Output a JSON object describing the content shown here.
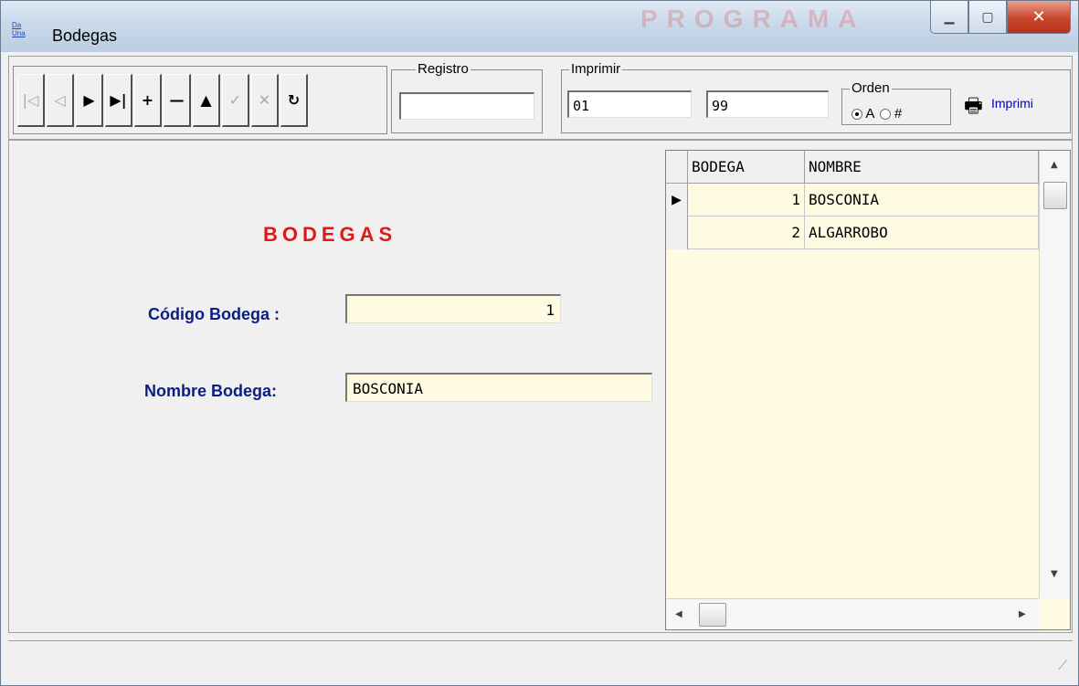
{
  "window": {
    "title": "Bodegas",
    "app_icon_text_top": "Da",
    "app_icon_text_bottom": "Una",
    "minimize_icon": "minimize-icon",
    "maximize_icon": "maximize-icon",
    "close_icon": "close-icon"
  },
  "toolbar": {
    "nav_buttons": [
      {
        "name": "first-record-icon",
        "glyph": "|◁",
        "enabled": false
      },
      {
        "name": "previous-record-icon",
        "glyph": "◁",
        "enabled": false
      },
      {
        "name": "next-record-icon",
        "glyph": "▶",
        "enabled": true
      },
      {
        "name": "last-record-icon",
        "glyph": "▶|",
        "enabled": true
      },
      {
        "name": "add-record-icon",
        "glyph": "+",
        "enabled": true
      },
      {
        "name": "delete-record-icon",
        "glyph": "—",
        "enabled": true
      },
      {
        "name": "edit-record-icon",
        "glyph": "▲",
        "enabled": true
      },
      {
        "name": "save-record-icon",
        "glyph": "✓",
        "enabled": false
      },
      {
        "name": "cancel-record-icon",
        "glyph": "✕",
        "enabled": false
      },
      {
        "name": "refresh-icon",
        "glyph": "↻",
        "enabled": true
      }
    ],
    "registro_label": "Registro",
    "registro_value": "",
    "imprimir_label": "Imprimir",
    "imprimir_from": "01",
    "imprimir_to": "99",
    "orden_label": "Orden",
    "orden_options": [
      "A",
      "#"
    ],
    "orden_selected": "A",
    "print_link": "Imprimi"
  },
  "form": {
    "heading": "BODEGAS",
    "codigo_label": "Código Bodega  :",
    "codigo_value": "1",
    "nombre_label": "Nombre Bodega:",
    "nombre_value": "BOSCONIA"
  },
  "grid": {
    "columns": [
      "BODEGA",
      "NOMBRE"
    ],
    "rows": [
      {
        "bodega": "1",
        "nombre": "BOSCONIA",
        "current": true
      },
      {
        "bodega": "2",
        "nombre": "ALGARROBO",
        "current": false
      }
    ]
  },
  "colors": {
    "heading": "#e01818",
    "label": "#0a1e82",
    "field_bg": "#fefbe2",
    "link": "#0000c0"
  }
}
